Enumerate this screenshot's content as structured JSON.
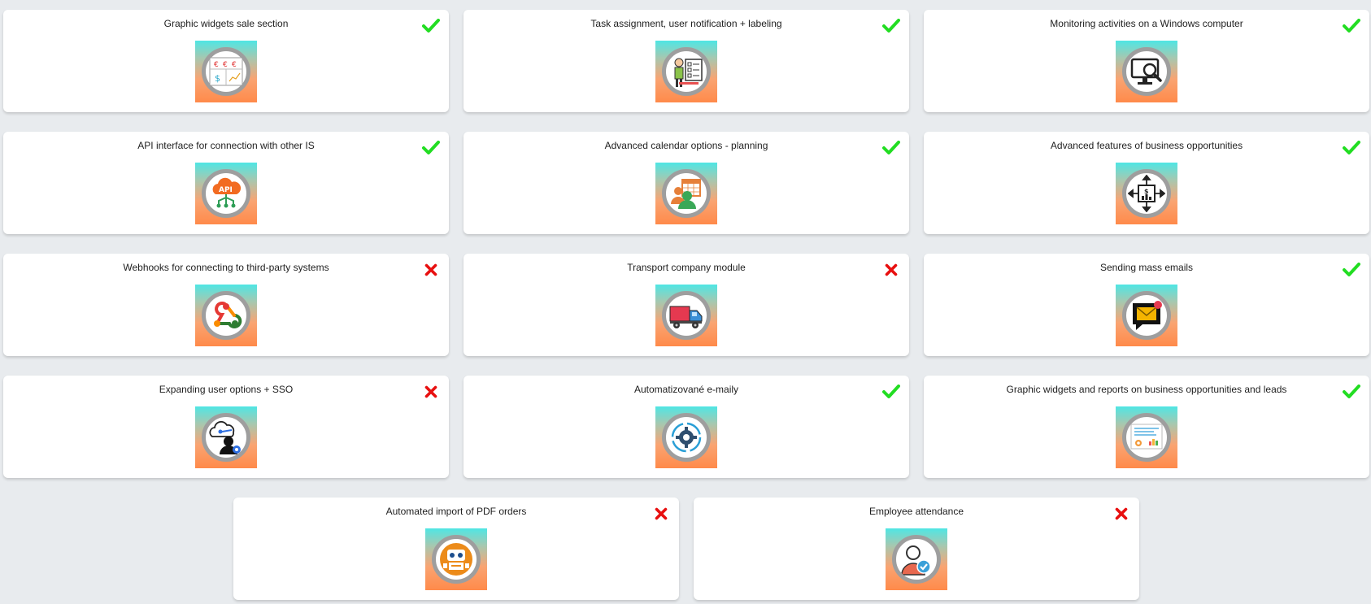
{
  "modules": [
    {
      "title": "Graphic widgets sale section",
      "status": "available",
      "icon": "currency-widgets-icon"
    },
    {
      "title": "Task assignment, user notification + labeling",
      "status": "available",
      "icon": "task-assignment-icon"
    },
    {
      "title": "Monitoring activities on a Windows computer",
      "status": "available",
      "icon": "monitor-search-icon"
    },
    {
      "title": "API interface for connection with other IS",
      "status": "available",
      "icon": "api-cloud-icon"
    },
    {
      "title": "Advanced calendar options - planning",
      "status": "available",
      "icon": "calendar-users-icon"
    },
    {
      "title": "Advanced features of business opportunities",
      "status": "available",
      "icon": "business-arrows-icon"
    },
    {
      "title": "Webhooks for connecting to third-party systems",
      "status": "unavailable",
      "icon": "webhook-icon"
    },
    {
      "title": "Transport company module",
      "status": "unavailable",
      "icon": "truck-icon"
    },
    {
      "title": "Sending mass emails",
      "status": "available",
      "icon": "mail-bubble-icon"
    },
    {
      "title": "Expanding user options + SSO",
      "status": "unavailable",
      "icon": "user-cloud-key-icon"
    },
    {
      "title": "Automatizované e-maily",
      "status": "available",
      "icon": "gear-cycle-icon"
    },
    {
      "title": "Graphic widgets and reports on business opportunities and leads",
      "status": "available",
      "icon": "report-dashboard-icon"
    },
    {
      "title": "Automated import of PDF orders",
      "status": "unavailable",
      "icon": "robot-icon"
    },
    {
      "title": "Employee attendance",
      "status": "unavailable",
      "icon": "employee-check-icon"
    }
  ],
  "colors": {
    "available": "#22dd22",
    "unavailable": "#e81010",
    "thumb_top": "#4fe6e4",
    "thumb_bottom": "#ff8a4a",
    "page_bg": "#e8ebee"
  },
  "icons": {
    "available": "checkmark-icon",
    "unavailable": "cross-icon"
  }
}
